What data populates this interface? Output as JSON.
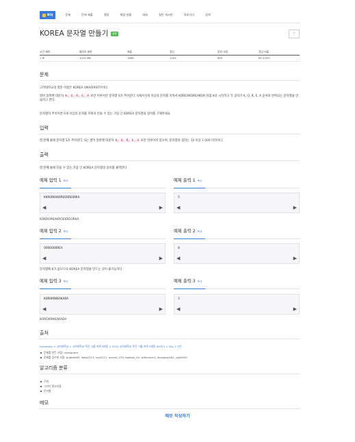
{
  "nav": {
    "brand": "BOJ",
    "items": [
      "문제",
      "문제 제출",
      "랭킹",
      "채점 현황",
      "대회",
      "질문 게시판",
      "뒤로가기",
      "검색"
    ]
  },
  "problem": {
    "title": "KOREA 문자열 만들기",
    "badge": "성공"
  },
  "info": {
    "headers": [
      "시간 제한",
      "메모리 제한",
      "제출",
      "정답",
      "맞힌 사람",
      "정답 비율"
    ],
    "values": [
      "1 초",
      "1024 MB",
      "1666",
      "1004",
      "895",
      "64.434%"
    ]
  },
  "sections": {
    "problem": "문제",
    "input": "입력",
    "output": "출력",
    "source": "출처",
    "algorithm": "알고리즘 분류",
    "memo": "메모"
  },
  "description": {
    "p1": "고려대학교의 영문 이름은 KOREA UNIVERSITY이다.",
    "p2a": "영어 알파벳 대문자",
    "p2code": "K, O, R, E, A",
    "p2b": "로만 이루어진 문자열 S가 주어진다. S에서 0개 이상의 문자를 지워서 KOREAKOREAKOR 처럼 K로 시작하고 각 글자가 K, O, R, E, A 순서로 반복되는 문자열을 만들려고 한다.",
    "p3": "문자열이 주어지면 0개 이상의 문자를 지워서 만들 수 있는 가장 긴 KOREA 문자열의 길이를 구해주세요."
  },
  "input_text": {
    "a": "첫 번째 줄에 문자열 S가 주어진다. S는 영어 알파벳 대문자",
    "code": "K, O, R, E, A",
    "b": "로만 이루어져 있으며, 문자열의 길이는 10 이상 1 000 이하이다."
  },
  "output_text": "첫 번째 줄에 만들 수 있는 가장 긴 KOREA 문자열의 길이를 출력한다.",
  "examples": [
    {
      "in_title": "예제 입력 1",
      "out_title": "예제 출력 1",
      "copy": "복사",
      "input": "KKRORKAKRROEKREORKA",
      "output": "5",
      "note": "KOKRORKAKROEKREORKA"
    },
    {
      "in_title": "예제 입력 2",
      "out_title": "예제 출력 2",
      "copy": "복사",
      "input": "OOOOOOOREA",
      "output": "0",
      "note": "문자열에 K가 없으므로 KOREA 문자열을 만드는 것이 불가능하다."
    },
    {
      "in_title": "예제 입력 3",
      "out_title": "예제 출력 3",
      "copy": "복사",
      "input": "KOROKRKKAKADA",
      "output": "3",
      "note": "KOROKRKKAKADA"
    }
  ],
  "source": {
    "prefix": "University > 고려대학교 > 고려대학교 주간 그룹 프로그래밍 > 2023 고려대학교 주간 그룹 프로그래밍 (KCPC) > Div. 2 1번",
    "items": [
      "문제를 만든 사람: rootsquare",
      "문제를 검수한 사람: bubbler89, lkdw0713, hyo0111, rpxnsd_079, toolbox_04, wiffontain1, dongwoo281, jsjw0000"
    ]
  },
  "algorithms": [
    "구현",
    "그리디 알고리즘",
    "문자열"
  ],
  "memo_link": "메모 작성하기",
  "colors": {
    "accent": "#3a7bd5",
    "badge": "#5cb85c"
  }
}
